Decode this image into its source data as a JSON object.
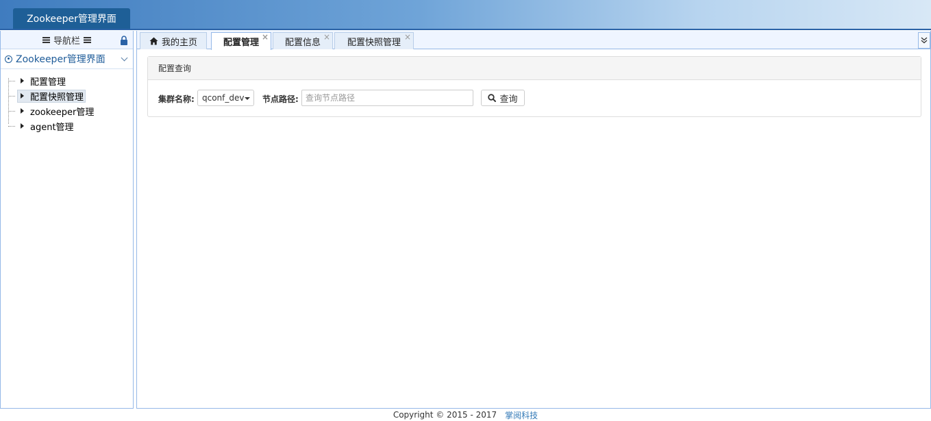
{
  "header": {
    "title": "Zookeeper管理界面"
  },
  "sidebar": {
    "title": "导航栏",
    "accordion_title": "Zookeeper管理界面",
    "items": [
      {
        "label": "配置管理",
        "selected": false
      },
      {
        "label": "配置快照管理",
        "selected": true
      },
      {
        "label": "zookeeper管理",
        "selected": false
      },
      {
        "label": "agent管理",
        "selected": false
      }
    ]
  },
  "tabs": [
    {
      "label": "我的主页",
      "closable": false,
      "active": false,
      "icon": "home-icon"
    },
    {
      "label": "配置管理",
      "closable": true,
      "active": true
    },
    {
      "label": "配置信息",
      "closable": true,
      "active": false
    },
    {
      "label": "配置快照管理",
      "closable": true,
      "active": false
    }
  ],
  "tab_close_glyph": "×",
  "panel": {
    "heading": "配置查询",
    "cluster_label": "集群名称:",
    "cluster_value": "qconf_dev",
    "path_label": "节点路径:",
    "path_placeholder": "查询节点路径",
    "path_value": "",
    "search_button": "查询"
  },
  "footer": {
    "copyright": "Copyright © 2015 - 2017",
    "company": "掌阅科技"
  },
  "colors": {
    "header_tab_bg": "#1e5f97",
    "border": "#95b8e7",
    "accent_text": "#1f5c99",
    "link": "#337ab7"
  }
}
